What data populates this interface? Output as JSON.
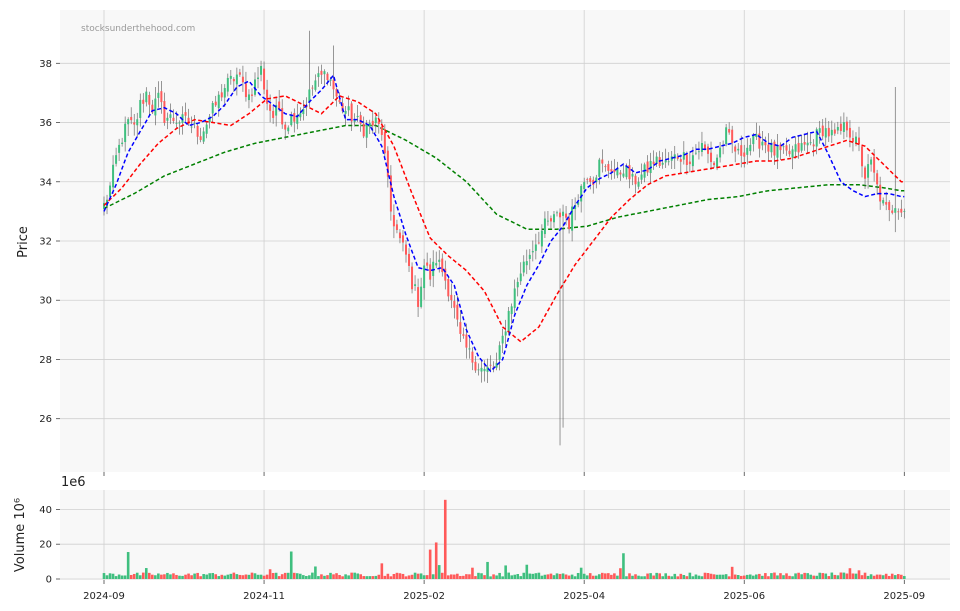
{
  "watermark": "stocksunderthehood.com",
  "chart_data": [
    {
      "type": "candlestick",
      "ylabel": "Price",
      "ylim": [
        24.2,
        39.8
      ],
      "yticks": [
        26,
        28,
        30,
        32,
        34,
        36,
        38
      ],
      "grid": true,
      "colors": {
        "up": "#3fbf7f",
        "down": "#ff5a5a",
        "ma_fast": "#0000ff",
        "ma_mid": "#ff0000",
        "ma_slow": "#008000",
        "background": "#f8f8f8",
        "grid": "#d0d0d0"
      },
      "price_anchors": {
        "x": [
          0,
          2,
          4,
          6,
          8,
          10,
          12,
          14,
          16,
          18,
          20,
          24,
          28,
          32,
          36,
          40,
          44,
          48,
          52,
          54,
          56,
          58,
          60,
          63,
          66,
          70,
          74,
          78,
          82,
          86,
          90,
          92,
          95,
          98,
          100,
          102,
          104,
          106,
          108,
          110,
          112,
          115,
          118,
          122,
          126,
          130,
          134,
          138,
          142,
          146,
          150,
          152,
          154,
          156,
          157,
          158,
          160,
          162,
          164,
          166,
          168,
          170,
          172,
          175,
          178,
          182,
          186,
          190,
          194,
          198,
          202,
          206,
          210,
          214,
          218,
          222,
          226,
          230,
          234,
          238,
          242,
          246,
          250,
          252,
          254,
          256,
          258,
          260,
          262,
          264
        ],
        "y": [
          33.2,
          33.8,
          34.8,
          35.5,
          36.0,
          35.8,
          36.6,
          37.0,
          36.5,
          36.8,
          36.2,
          36.1,
          36.0,
          35.6,
          36.4,
          37.2,
          37.6,
          36.9,
          37.8,
          36.7,
          36.2,
          36.5,
          35.9,
          36.3,
          36.5,
          37.4,
          37.7,
          36.6,
          36.2,
          35.8,
          36.0,
          35.7,
          33.0,
          32.0,
          31.5,
          30.6,
          30.0,
          31.2,
          30.8,
          31.4,
          31.0,
          30.1,
          28.7,
          28.0,
          27.6,
          27.8,
          29.6,
          31.0,
          31.8,
          32.5,
          32.8,
          33.0,
          32.6,
          33.3,
          33.6,
          33.8,
          34.3,
          34.1,
          34.6,
          34.4,
          34.5,
          34.2,
          34.5,
          34.0,
          34.2,
          34.7,
          34.6,
          34.9,
          34.8,
          35.2,
          34.6,
          35.6,
          34.9,
          35.3,
          35.4,
          35.0,
          34.9,
          35.1,
          35.3,
          35.8,
          35.5,
          35.9,
          35.1,
          34.2,
          34.6,
          33.8,
          33.2,
          32.9,
          33.3,
          33.1
        ],
        "spikes": [
          {
            "x": 68,
            "high": 39.1
          },
          {
            "x": 76,
            "high": 38.6
          },
          {
            "x": 151,
            "low": 25.1
          },
          {
            "x": 152,
            "low": 25.7
          },
          {
            "x": 262,
            "high": 37.2
          },
          {
            "x": 262,
            "low": 32.3
          }
        ]
      },
      "moving_averages": {
        "ma_fast": {
          "x": [
            0,
            4,
            8,
            12,
            16,
            20,
            24,
            28,
            32,
            36,
            40,
            44,
            48,
            52,
            56,
            60,
            64,
            68,
            72,
            76,
            80,
            84,
            88,
            92,
            96,
            100,
            104,
            108,
            112,
            116,
            120,
            124,
            128,
            132,
            136,
            140,
            144,
            148,
            152,
            156,
            160,
            164,
            168,
            172,
            176,
            180,
            184,
            188,
            192,
            196,
            200,
            204,
            208,
            212,
            216,
            220,
            224,
            228,
            232,
            236,
            240,
            244,
            248,
            252,
            256,
            260,
            264
          ],
          "y": [
            33.0,
            33.9,
            35.0,
            35.7,
            36.4,
            36.5,
            36.3,
            35.9,
            36.0,
            36.2,
            36.6,
            37.2,
            37.4,
            36.9,
            36.6,
            36.3,
            36.2,
            36.7,
            37.1,
            37.6,
            36.1,
            36.1,
            35.9,
            35.2,
            33.5,
            32.2,
            31.1,
            31.0,
            31.1,
            30.5,
            29.0,
            28.1,
            27.6,
            28.0,
            29.5,
            30.5,
            31.2,
            32.0,
            32.5,
            33.2,
            33.8,
            34.1,
            34.3,
            34.6,
            34.3,
            34.4,
            34.7,
            34.8,
            34.9,
            35.1,
            35.1,
            35.2,
            35.3,
            35.5,
            35.6,
            35.3,
            35.2,
            35.5,
            35.6,
            35.7,
            34.9,
            34.0,
            33.7,
            33.5,
            33.6,
            33.6,
            33.5
          ]
        },
        "ma_mid": {
          "x": [
            0,
            6,
            12,
            18,
            24,
            30,
            36,
            42,
            48,
            54,
            60,
            66,
            72,
            78,
            84,
            90,
            96,
            102,
            108,
            114,
            120,
            126,
            132,
            138,
            144,
            150,
            156,
            162,
            168,
            174,
            180,
            186,
            192,
            198,
            204,
            210,
            216,
            222,
            228,
            234,
            240,
            246,
            252,
            258,
            264
          ],
          "y": [
            33.2,
            33.8,
            34.6,
            35.3,
            35.8,
            36.1,
            36.0,
            35.9,
            36.3,
            36.8,
            36.9,
            36.6,
            36.3,
            36.9,
            36.7,
            36.3,
            35.2,
            33.6,
            32.1,
            31.5,
            31.0,
            30.3,
            29.1,
            28.6,
            29.1,
            30.2,
            31.2,
            32.0,
            32.8,
            33.4,
            33.9,
            34.2,
            34.3,
            34.4,
            34.5,
            34.6,
            34.7,
            34.7,
            34.8,
            35.0,
            35.2,
            35.4,
            35.2,
            34.6,
            34.0
          ]
        },
        "ma_slow": {
          "x": [
            0,
            10,
            20,
            30,
            40,
            50,
            60,
            70,
            80,
            90,
            100,
            110,
            120,
            130,
            140,
            150,
            160,
            170,
            180,
            190,
            200,
            210,
            220,
            230,
            240,
            250,
            258,
            264
          ],
          "y": [
            33.1,
            33.6,
            34.2,
            34.6,
            35.0,
            35.3,
            35.5,
            35.7,
            35.9,
            35.9,
            35.4,
            34.8,
            34.0,
            32.9,
            32.4,
            32.4,
            32.5,
            32.8,
            33.0,
            33.2,
            33.4,
            33.5,
            33.7,
            33.8,
            33.9,
            33.9,
            33.8,
            33.7
          ]
        }
      },
      "x_ticks": {
        "labels": [
          "2024-09",
          "2024-11",
          "2025-02",
          "2025-04",
          "2025-06",
          "2025-09"
        ],
        "index": [
          0,
          53,
          106,
          159,
          212,
          265
        ]
      }
    },
    {
      "type": "bar",
      "ylabel": "Volume  10⁶",
      "offset_label": "1e6",
      "ylim": [
        0,
        50
      ],
      "yticks": [
        0,
        20,
        40
      ],
      "unit": "millions of shares",
      "typical_volume": 2.5,
      "volume_spikes": [
        {
          "x": 8,
          "v": 15.5
        },
        {
          "x": 14,
          "v": 6.3
        },
        {
          "x": 55,
          "v": 5.6
        },
        {
          "x": 62,
          "v": 15.8
        },
        {
          "x": 70,
          "v": 7.2
        },
        {
          "x": 92,
          "v": 9.0
        },
        {
          "x": 108,
          "v": 16.9
        },
        {
          "x": 110,
          "v": 21.0
        },
        {
          "x": 111,
          "v": 8.0
        },
        {
          "x": 113,
          "v": 45.5
        },
        {
          "x": 122,
          "v": 6.5
        },
        {
          "x": 127,
          "v": 9.8
        },
        {
          "x": 133,
          "v": 7.8
        },
        {
          "x": 140,
          "v": 8.2
        },
        {
          "x": 158,
          "v": 6.5
        },
        {
          "x": 171,
          "v": 6.2
        },
        {
          "x": 172,
          "v": 14.8
        },
        {
          "x": 208,
          "v": 7.0
        },
        {
          "x": 247,
          "v": 6.2
        },
        {
          "x": 250,
          "v": 5.0
        }
      ]
    }
  ]
}
